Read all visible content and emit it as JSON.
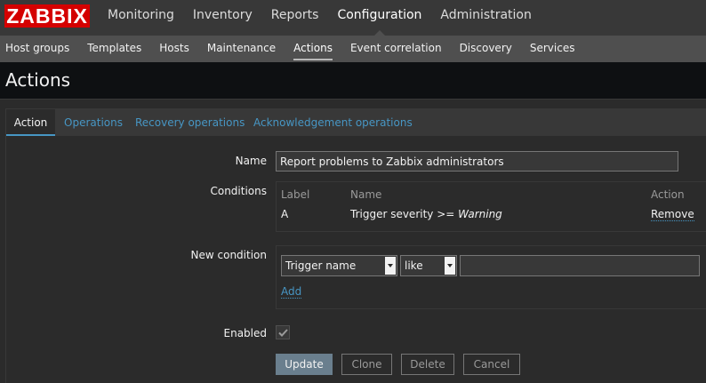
{
  "logo": "ZABBIX",
  "top_menu": [
    {
      "label": "Monitoring"
    },
    {
      "label": "Inventory"
    },
    {
      "label": "Reports"
    },
    {
      "label": "Configuration"
    },
    {
      "label": "Administration"
    }
  ],
  "sub_menu": [
    {
      "label": "Host groups"
    },
    {
      "label": "Templates"
    },
    {
      "label": "Hosts"
    },
    {
      "label": "Maintenance"
    },
    {
      "label": "Actions"
    },
    {
      "label": "Event correlation"
    },
    {
      "label": "Discovery"
    },
    {
      "label": "Services"
    }
  ],
  "page_title": "Actions",
  "tabs": [
    {
      "label": "Action"
    },
    {
      "label": "Operations"
    },
    {
      "label": "Recovery operations"
    },
    {
      "label": "Acknowledgement operations"
    }
  ],
  "form": {
    "name_label": "Name",
    "name_value": "Report problems to Zabbix administrators",
    "conditions_label": "Conditions",
    "conditions_headers": {
      "label": "Label",
      "name": "Name",
      "action": "Action"
    },
    "conditions_rows": [
      {
        "label": "A",
        "name_prefix": "Trigger severity >= ",
        "name_value": "Warning",
        "action": "Remove"
      }
    ],
    "new_condition_label": "New condition",
    "new_condition_type": "Trigger name",
    "new_condition_operator": "like",
    "new_condition_value": "",
    "add_link": "Add",
    "enabled_label": "Enabled",
    "enabled": true
  },
  "buttons": {
    "update": "Update",
    "clone": "Clone",
    "delete": "Delete",
    "cancel": "Cancel"
  },
  "colors": {
    "brand": "#d40000",
    "link": "#4796c4",
    "primary_button": "#6a7f8e",
    "background": "#2b2b2b"
  }
}
